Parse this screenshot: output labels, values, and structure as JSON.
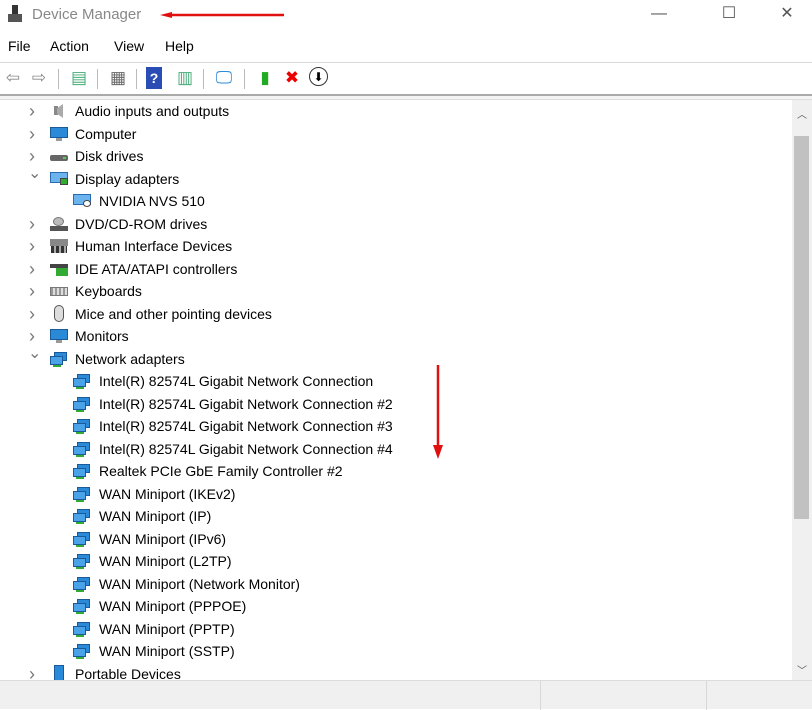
{
  "window": {
    "title": "Device Manager",
    "minimize": "—",
    "maximize": "☐",
    "close": "✕"
  },
  "menu": [
    "File",
    "Action",
    "View",
    "Help"
  ],
  "toolbar": [
    {
      "name": "back-icon",
      "glyph": "⇦",
      "color": "#888"
    },
    {
      "name": "forward-icon",
      "glyph": "⇨",
      "color": "#888"
    },
    {
      "name": "show-hide-console-tree-icon",
      "glyph": "▤",
      "color": "#4a7"
    },
    {
      "name": "properties-icon",
      "glyph": "▦",
      "color": "#666"
    },
    {
      "name": "help-icon",
      "glyph": "?",
      "color": "#fff",
      "bg": "#2a4db5"
    },
    {
      "name": "show-action-pane-icon",
      "glyph": "▥",
      "color": "#4a7"
    },
    {
      "name": "scan-hardware-icon",
      "glyph": "🖵",
      "color": "#2a8ad8"
    },
    {
      "name": "update-driver-icon",
      "glyph": "▮",
      "color": "#2a2"
    },
    {
      "name": "uninstall-icon",
      "glyph": "✖",
      "color": "#e00"
    },
    {
      "name": "disable-device-icon",
      "glyph": "⬇",
      "color": "#000"
    }
  ],
  "tree": [
    {
      "label": "Audio inputs and outputs",
      "level": 0,
      "state": "collapsed",
      "icon": "speaker"
    },
    {
      "label": "Computer",
      "level": 0,
      "state": "collapsed",
      "icon": "monitor"
    },
    {
      "label": "Disk drives",
      "level": 0,
      "state": "collapsed",
      "icon": "disk"
    },
    {
      "label": "Display adapters",
      "level": 0,
      "state": "expanded",
      "icon": "display"
    },
    {
      "label": "NVIDIA NVS 510",
      "level": 1,
      "icon": "display-device"
    },
    {
      "label": "DVD/CD-ROM drives",
      "level": 0,
      "state": "collapsed",
      "icon": "dvd"
    },
    {
      "label": "Human Interface Devices",
      "level": 0,
      "state": "collapsed",
      "icon": "hid"
    },
    {
      "label": "IDE ATA/ATAPI controllers",
      "level": 0,
      "state": "collapsed",
      "icon": "ide"
    },
    {
      "label": "Keyboards",
      "level": 0,
      "state": "collapsed",
      "icon": "keyboard"
    },
    {
      "label": "Mice and other pointing devices",
      "level": 0,
      "state": "collapsed",
      "icon": "mouse"
    },
    {
      "label": "Monitors",
      "level": 0,
      "state": "collapsed",
      "icon": "monitor"
    },
    {
      "label": "Network adapters",
      "level": 0,
      "state": "expanded",
      "icon": "network"
    },
    {
      "label": "Intel(R) 82574L Gigabit Network Connection",
      "level": 1,
      "icon": "network"
    },
    {
      "label": "Intel(R) 82574L Gigabit Network Connection #2",
      "level": 1,
      "icon": "network"
    },
    {
      "label": "Intel(R) 82574L Gigabit Network Connection #3",
      "level": 1,
      "icon": "network"
    },
    {
      "label": "Intel(R) 82574L Gigabit Network Connection #4",
      "level": 1,
      "icon": "network"
    },
    {
      "label": "Realtek PCIe GbE Family Controller #2",
      "level": 1,
      "icon": "network"
    },
    {
      "label": "WAN Miniport (IKEv2)",
      "level": 1,
      "icon": "network"
    },
    {
      "label": "WAN Miniport (IP)",
      "level": 1,
      "icon": "network"
    },
    {
      "label": "WAN Miniport (IPv6)",
      "level": 1,
      "icon": "network"
    },
    {
      "label": "WAN Miniport (L2TP)",
      "level": 1,
      "icon": "network"
    },
    {
      "label": "WAN Miniport (Network Monitor)",
      "level": 1,
      "icon": "network"
    },
    {
      "label": "WAN Miniport (PPPOE)",
      "level": 1,
      "icon": "network"
    },
    {
      "label": "WAN Miniport (PPTP)",
      "level": 1,
      "icon": "network"
    },
    {
      "label": "WAN Miniport (SSTP)",
      "level": 1,
      "icon": "network"
    },
    {
      "label": "Portable Devices",
      "level": 0,
      "state": "collapsed",
      "icon": "portable"
    }
  ],
  "colors": {
    "annotation": "#e01010",
    "icon_blue": "#2a8ad8",
    "icon_green": "#3a3"
  }
}
